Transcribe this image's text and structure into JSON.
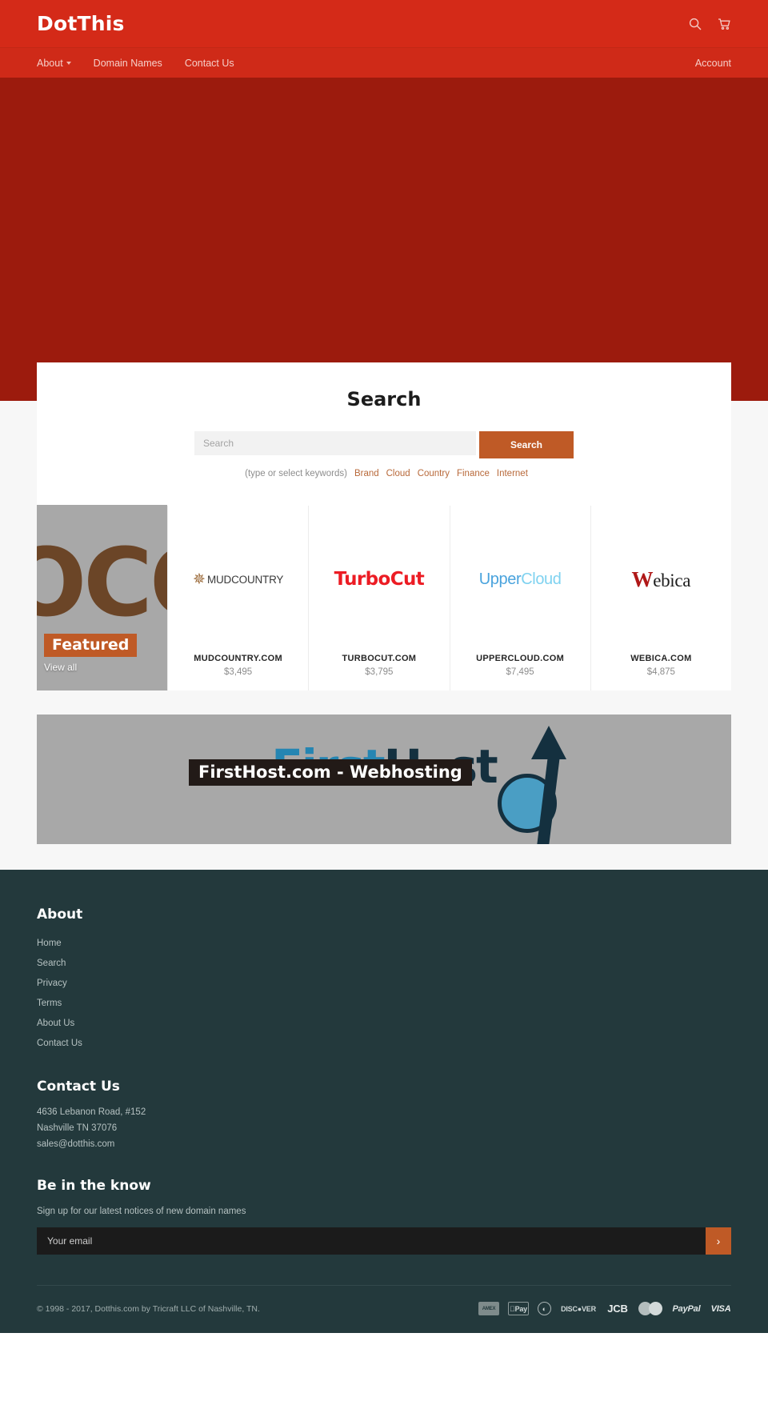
{
  "header": {
    "logo": "DotThis",
    "search_icon": "search-icon",
    "cart_icon": "cart-icon"
  },
  "nav": {
    "items": [
      {
        "label": "About",
        "has_caret": true
      },
      {
        "label": "Domain Names",
        "has_caret": false
      },
      {
        "label": "Contact Us",
        "has_caret": false
      }
    ],
    "account_label": "Account"
  },
  "search_panel": {
    "title": "Search",
    "input_placeholder": "Search",
    "input_value": "",
    "button_label": "Search",
    "keywords_hint": "(type or select keywords)",
    "keywords": [
      "Brand",
      "Cloud",
      "Country",
      "Finance",
      "Internet"
    ]
  },
  "featured": {
    "badge": "Featured",
    "view_all": "View all",
    "bg_text": "OCO",
    "products": [
      {
        "logo_kind": "mudcountry",
        "logo_text": "MUDCOUNTRY",
        "title": "MUDCOUNTRY.COM",
        "price": "$3,495"
      },
      {
        "logo_kind": "turbocut",
        "logo_text": "TurboCut",
        "title": "TURBOCUT.COM",
        "price": "$3,795"
      },
      {
        "logo_kind": "uppercloud",
        "logo_text_a": "Upper",
        "logo_text_b": "Cloud",
        "title": "UPPERCLOUD.COM",
        "price": "$7,495"
      },
      {
        "logo_kind": "webica",
        "logo_text_w": "W",
        "logo_text_rest": "ebica",
        "title": "WEBICA.COM",
        "price": "$4,875"
      }
    ]
  },
  "banner": {
    "label": "FirstHost.com - Webhosting",
    "art_first": "First",
    "art_host": "H  st"
  },
  "footer": {
    "about_heading": "About",
    "about_links": [
      "Home",
      "Search",
      "Privacy",
      "Terms",
      "About Us",
      "Contact Us"
    ],
    "contact_heading": "Contact Us",
    "contact_lines": [
      "4636 Lebanon Road, #152",
      "Nashville TN 37076",
      "sales@dotthis.com"
    ],
    "newsletter_heading": "Be in the know",
    "newsletter_desc": "Sign up for our latest notices of new domain names",
    "newsletter_placeholder": "Your email",
    "newsletter_value": "",
    "newsletter_button_icon": "chevron-right-icon",
    "copyright": "© 1998 - 2017, Dotthis.com by Tricraft LLC of Nashville, TN.",
    "payment_methods": [
      "American Express",
      "Apple Pay",
      "Diners Club",
      "DISCⓨVER",
      "JCB",
      "Mastercard",
      "PayPal",
      "VISA"
    ]
  },
  "colors": {
    "header_red": "#d42a18",
    "nav_red": "#cf2a18",
    "hero_red": "#9c1b0d",
    "accent_orange": "#bf5a26",
    "footer_teal": "#23393c"
  }
}
